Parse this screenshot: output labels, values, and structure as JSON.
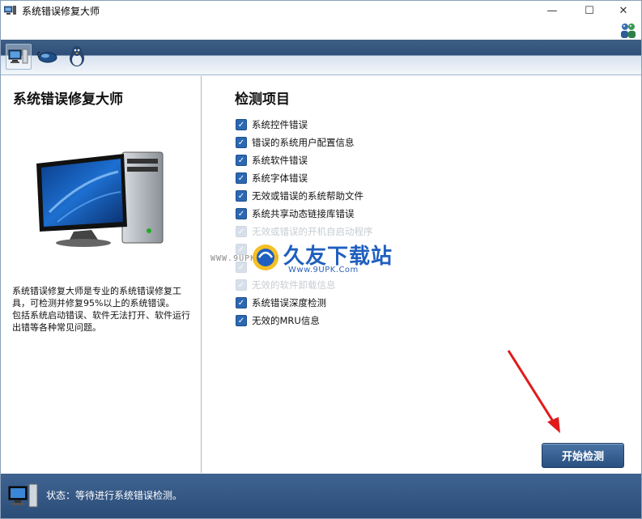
{
  "window": {
    "title": "系统错误修复大师",
    "controls": {
      "minimize": "—",
      "maximize": "☐",
      "close": "✕"
    }
  },
  "toolbar": {
    "buttons": [
      {
        "icon": "computer-icon",
        "active": true
      },
      {
        "icon": "mouse-icon",
        "active": false
      },
      {
        "icon": "penguin-icon",
        "active": false
      }
    ]
  },
  "left": {
    "title": "系统错误修复大师",
    "description": "系统错误修复大师是专业的系统错误修复工具，可检测并修复95%以上的系统错误。\n包括系统启动错误、软件无法打开、软件运行出错等各种常见问题。"
  },
  "right": {
    "title": "检测项目",
    "items": [
      {
        "label": "系统控件错误",
        "checked": true,
        "faded": false
      },
      {
        "label": "错误的系统用户配置信息",
        "checked": true,
        "faded": false
      },
      {
        "label": "系统软件错误",
        "checked": true,
        "faded": false
      },
      {
        "label": "系统字体错误",
        "checked": true,
        "faded": false
      },
      {
        "label": "无效或错误的系统帮助文件",
        "checked": true,
        "faded": false
      },
      {
        "label": "系统共享动态链接库错误",
        "checked": true,
        "faded": false
      },
      {
        "label": "无效或错误的开机自启动程序",
        "checked": true,
        "faded": true
      },
      {
        "label": "",
        "checked": true,
        "faded": true
      },
      {
        "label": "",
        "checked": true,
        "faded": true
      },
      {
        "label": "无效的软件卸载信息",
        "checked": true,
        "faded": true
      },
      {
        "label": "系统错误深度检测",
        "checked": true,
        "faded": false
      },
      {
        "label": "无效的MRU信息",
        "checked": true,
        "faded": false
      }
    ],
    "start_button": "开始检测"
  },
  "watermark": {
    "url_left": "WWW.9UPK.COM",
    "name": "久友下载站",
    "url": "Www.9UPK.Com"
  },
  "status": {
    "text": "状态：等待进行系统错误检测。"
  },
  "colors": {
    "accent": "#2b68b3",
    "status_bar": "#2f527e",
    "arrow": "#e01b1b"
  }
}
